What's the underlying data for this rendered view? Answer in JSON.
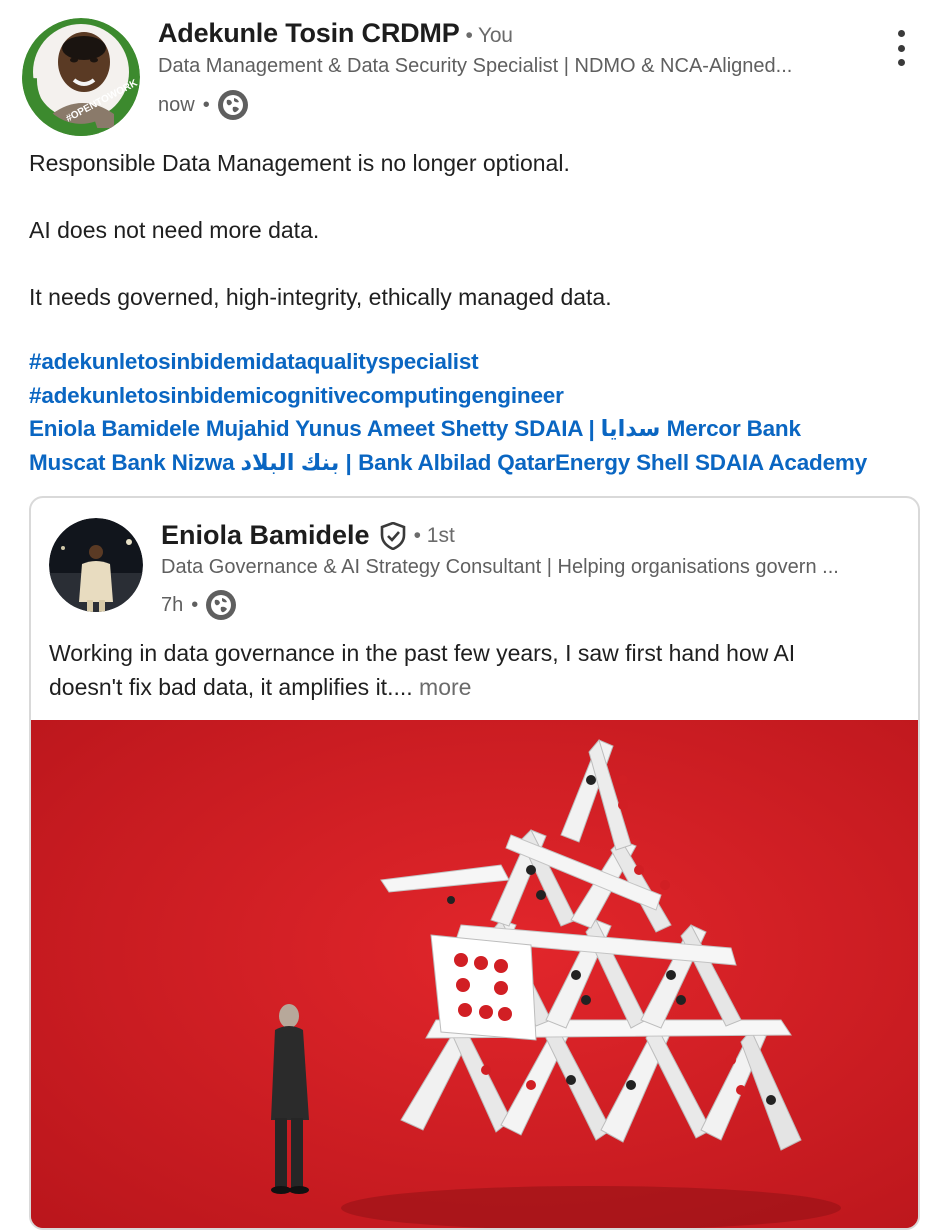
{
  "author": {
    "name": "Adekunle Tosin CRDMP",
    "relation": "You",
    "headline": "Data Management & Data Security Specialist | NDMO & NCA-Aligned...",
    "time": "now",
    "avatar_frame_text": "#OPENTOWORK",
    "frame_color": "#3c8a2e"
  },
  "post": {
    "lines": [
      "Responsible Data Management is no longer optional.",
      "AI does not need more data.",
      "It needs governed, high-integrity, ethically managed data."
    ],
    "hashtags": [
      "#adekunletosinbidemidataqualityspecialist",
      "#adekunletosinbidemicognitivecomputingengineer"
    ],
    "mentions_line1": [
      "Eniola Bamidele",
      "Mujahid Yunus",
      "Ameet Shetty",
      "SDAIA | سدايا",
      "Mercor",
      "Bank"
    ],
    "mentions_line2": [
      "Muscat",
      "Bank Nizwa بنك البلاد | Bank Albilad",
      "QatarEnergy",
      "Shell",
      "SDAIA Academy"
    ],
    "link_color": "#0a66c2"
  },
  "shared": {
    "name": "Eniola Bamidele",
    "degree": "1st",
    "headline": "Data Governance & AI Strategy Consultant | Helping organisations govern ...",
    "time": "7h",
    "text_line1": "Working in data governance in the past few years, I saw first hand how AI",
    "text_line2": "doesn't fix bad data, it amplifies it....",
    "more_label": "more",
    "image_background": "#d11f24"
  },
  "icons": {
    "globe": "globe-icon",
    "verified": "verified-shield-icon",
    "overflow": "more-vertical-icon"
  }
}
